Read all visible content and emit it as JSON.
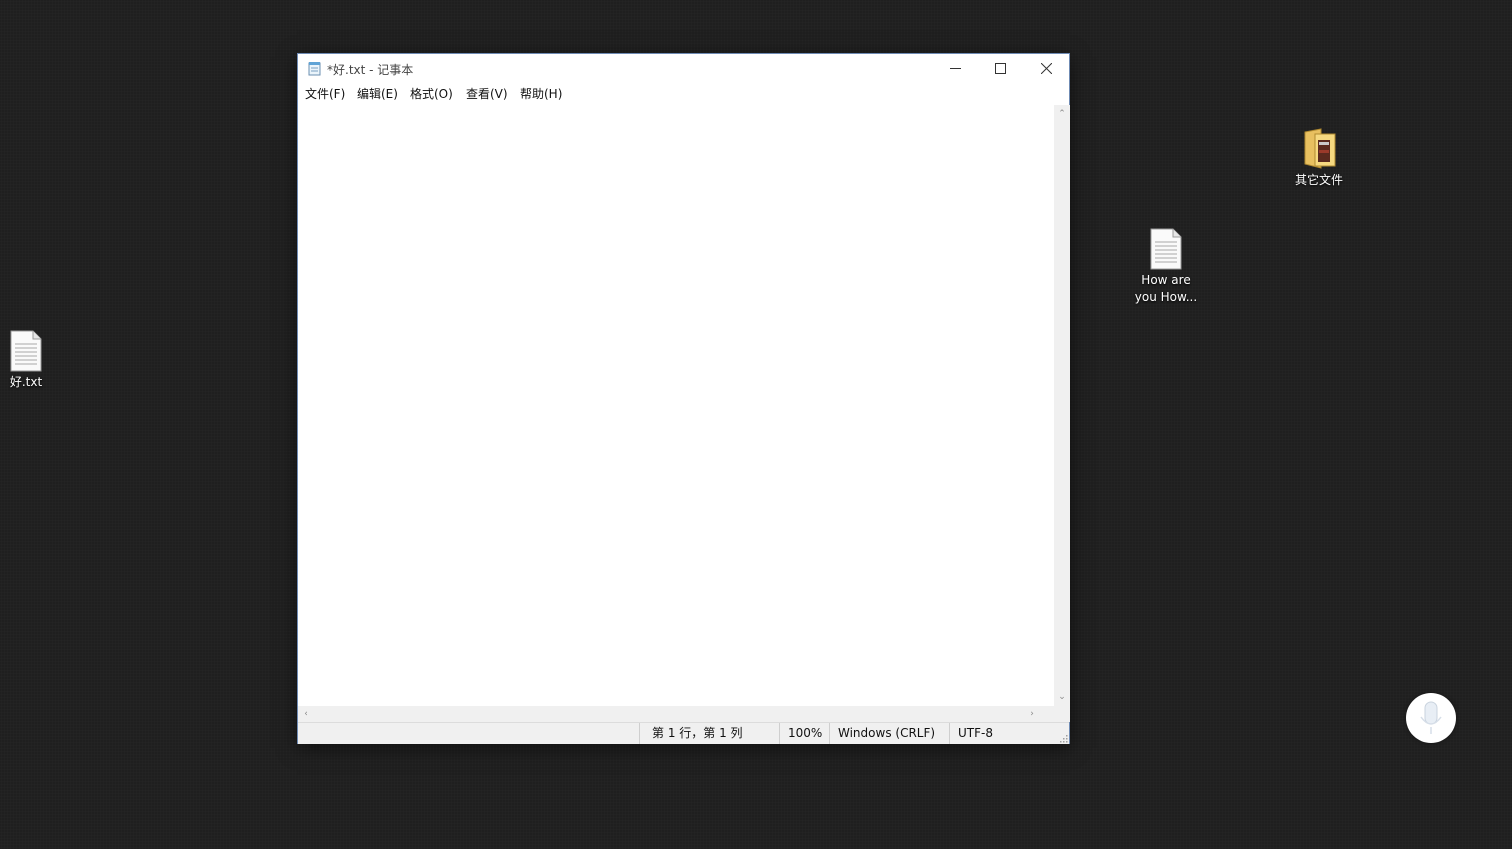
{
  "desktop": {
    "icons": [
      {
        "label": "好.txt",
        "icon": "text-file-icon"
      },
      {
        "label": "How are you How...",
        "icon": "text-file-icon"
      },
      {
        "label": "其它文件",
        "icon": "folder-icon"
      }
    ]
  },
  "window": {
    "title": "*好.txt - 记事本",
    "app_icon": "notepad-icon",
    "menu": [
      "文件(F)",
      "编辑(E)",
      "格式(O)",
      "查看(V)",
      "帮助(H)"
    ],
    "content": "",
    "status": {
      "position": "第 1 行，第 1 列",
      "zoom": "100%",
      "line_ending": "Windows (CRLF)",
      "encoding": "UTF-8"
    }
  },
  "colors": {
    "desktop_bg": "#1f1f1f",
    "window_border": "#6f8bb4",
    "statusbar_bg": "#f0f0f0"
  }
}
